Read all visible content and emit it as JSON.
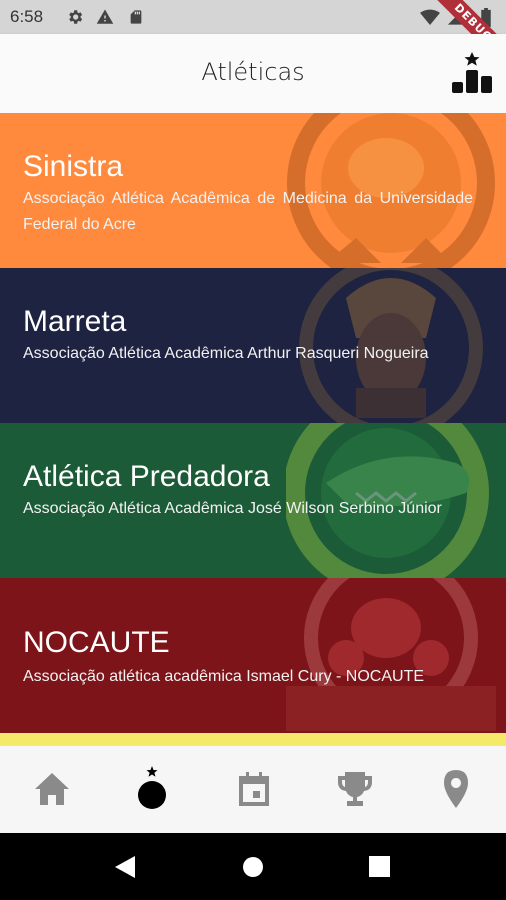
{
  "status_bar": {
    "time": "6:58",
    "debug_label": "DEBUG"
  },
  "app_bar": {
    "title": "Atléticas"
  },
  "cards": [
    {
      "name": "Sinistra",
      "description": "Associação Atlética Acadêmica de Medicina da Universidade Federal do Acre",
      "color": "#ff8a3d"
    },
    {
      "name": "Marreta",
      "description": "Associação Atlética Acadêmica Arthur Rasqueri Nogueira",
      "color": "#1d2340"
    },
    {
      "name": "Atlética Predadora",
      "description": "Associação Atlética Acadêmica José Wilson Serbino Júnior",
      "color": "#1c5b37"
    },
    {
      "name": "NOCAUTE",
      "description": "Associação atlética acadêmica Ismael Cury - NOCAUTE",
      "color": "#7d1419"
    }
  ],
  "next_card_color": "#f5e96a",
  "bottom_nav": {
    "items": [
      "home-icon",
      "atleticas-icon",
      "calendar-icon",
      "trophy-icon",
      "location-icon"
    ],
    "active": "atleticas-icon"
  }
}
